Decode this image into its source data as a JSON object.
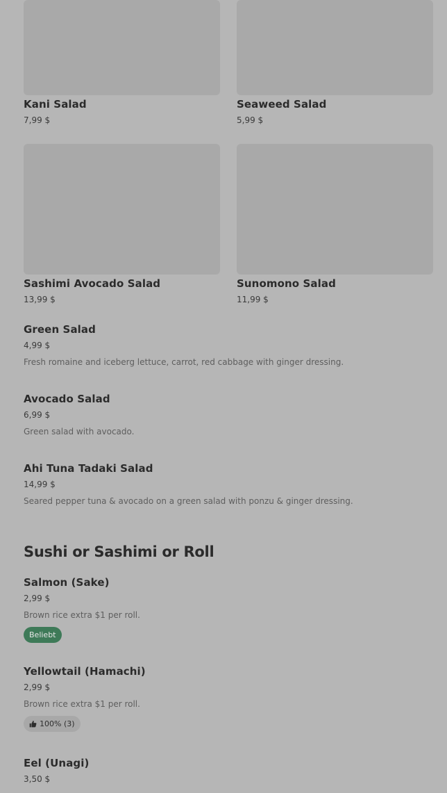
{
  "cards": [
    {
      "name": "Kani Salad",
      "price": "7,99 $"
    },
    {
      "name": "Seaweed Salad",
      "price": "5,99 $"
    },
    {
      "name": "Sashimi Avocado Salad",
      "price": "13,99 $"
    },
    {
      "name": "Sunomono Salad",
      "price": "11,99 $"
    }
  ],
  "salads": [
    {
      "name": "Green Salad",
      "price": "4,99 $",
      "description": "Fresh romaine and iceberg lettuce, carrot, red cabbage with ginger dressing."
    },
    {
      "name": "Avocado Salad",
      "price": "6,99 $",
      "description": "Green salad with avocado."
    },
    {
      "name": "Ahi Tuna Tadaki Salad",
      "price": "14,99 $",
      "description": "Seared pepper tuna & avocado on a green salad with ponzu & ginger dressing."
    }
  ],
  "section": {
    "title": "Sushi or Sashimi or Roll"
  },
  "sushi": [
    {
      "name": "Salmon (Sake)",
      "price": "2,99 $",
      "description": "Brown rice extra $1 per roll.",
      "badge": "Beliebt"
    },
    {
      "name": "Yellowtail (Hamachi)",
      "price": "2,99 $",
      "description": "Brown rice extra $1 per roll.",
      "rating": "100% (3)",
      "rating_icon": "thumbs-up-icon"
    },
    {
      "name": "Eel (Unagi)",
      "price": "3,50 $"
    }
  ],
  "colors": {
    "background": "#b6b6b6",
    "image_placeholder": "#a9a9a9",
    "popular_badge": "#3e7a58"
  }
}
